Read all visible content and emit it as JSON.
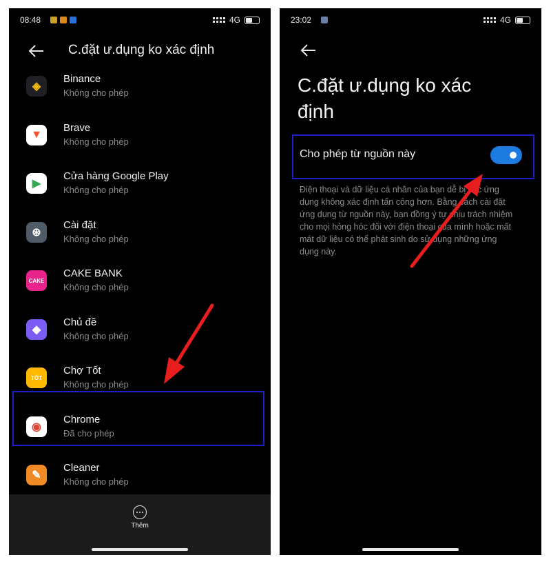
{
  "left": {
    "status": {
      "time": "08:48",
      "network": "4G"
    },
    "title": "C.đặt ư.dụng ko xác định",
    "apps": [
      {
        "name": "Binance",
        "status": "Không cho phép",
        "icon": "binance-icon",
        "bg": "#1e2026",
        "fg": "#f0b90b",
        "glyph": "◈"
      },
      {
        "name": "Brave",
        "status": "Không cho phép",
        "icon": "brave-icon",
        "bg": "#ffffff",
        "fg": "#fb542b",
        "glyph": "▼"
      },
      {
        "name": "Cửa hàng Google Play",
        "status": "Không cho phép",
        "icon": "google-play-icon",
        "bg": "#ffffff",
        "fg": "#34a853",
        "glyph": "▶"
      },
      {
        "name": "Cài đặt",
        "status": "Không cho phép",
        "icon": "settings-icon",
        "bg": "#4f5b66",
        "fg": "#ffffff",
        "glyph": "⊛"
      },
      {
        "name": "CAKE BANK",
        "status": "Không cho phép",
        "icon": "cake-bank-icon",
        "bg": "#e8248c",
        "fg": "#ffffff",
        "glyph": "CAKE"
      },
      {
        "name": "Chủ đề",
        "status": "Không cho phép",
        "icon": "themes-icon",
        "bg": "#7b5cf5",
        "fg": "#ffffff",
        "glyph": "◆"
      },
      {
        "name": "Chợ Tốt",
        "status": "Không cho phép",
        "icon": "cho-tot-icon",
        "bg": "#ffba00",
        "fg": "#ffffff",
        "glyph": "TỐT"
      },
      {
        "name": "Chrome",
        "status": "Đã cho phép",
        "icon": "chrome-icon",
        "bg": "#ffffff",
        "fg": "#db4437",
        "glyph": "◉"
      },
      {
        "name": "Cleaner",
        "status": "Không cho phép",
        "icon": "cleaner-icon",
        "bg": "#f08a24",
        "fg": "#ffffff",
        "glyph": "✎"
      }
    ],
    "more_label": "Thêm"
  },
  "right": {
    "status": {
      "time": "23:02",
      "network": "4G"
    },
    "title": "C.đặt ư.dụng ko xác định",
    "toggle_label": "Cho phép từ nguồn này",
    "toggle_on": true,
    "description": "Điện thoại và dữ liệu cá nhân của bạn dễ bị các ứng dụng không xác định tấn công hơn. Bằng cách cài đặt ứng dụng từ nguồn này, bạn đồng ý tự chịu trách nhiệm cho mọi hỏng hóc đối với điện thoại của mình hoặc mất mát dữ liệu có thể phát sinh do sử dụng những ứng dụng này."
  },
  "colors": {
    "highlight": "#1e1ec8",
    "arrow": "#e81e1e",
    "toggle": "#1e7be0"
  }
}
